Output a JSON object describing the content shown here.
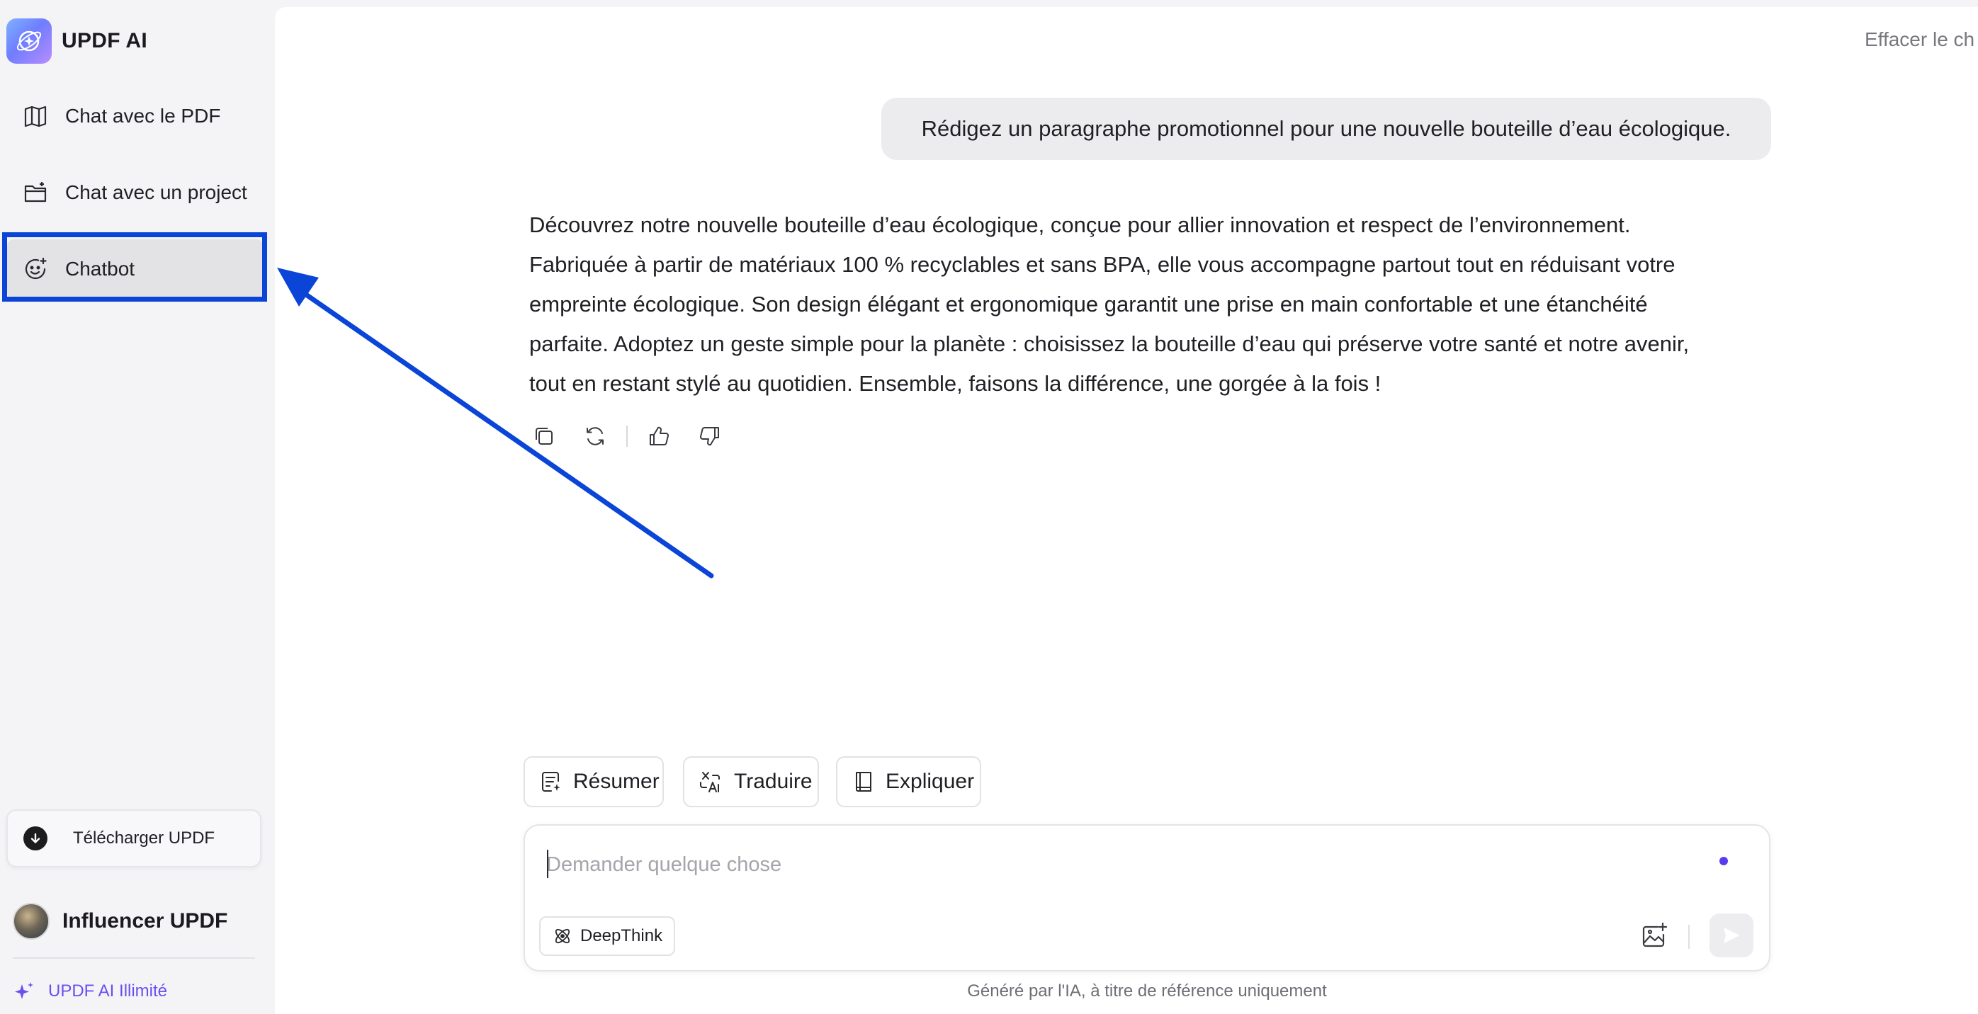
{
  "brand": {
    "name": "UPDF AI"
  },
  "sidebar": {
    "items": [
      {
        "label": "Chat avec le PDF",
        "icon": "book-icon"
      },
      {
        "label": "Chat avec un project",
        "icon": "folder-icon"
      },
      {
        "label": "Chatbot",
        "icon": "bot-icon",
        "active": true
      }
    ],
    "download": {
      "label": "Télécharger UPDF",
      "icon": "download-icon"
    },
    "user": {
      "name": "Influencer UPDF"
    },
    "plan": {
      "label": "UPDF AI Illimité",
      "color": "#6b4ef0"
    }
  },
  "header": {
    "clear_label": "Effacer le ch"
  },
  "conversation": {
    "user_message": "Rédigez un paragraphe promotionnel pour une nouvelle bouteille d’eau écologique.",
    "answer_lines": [
      "Découvrez notre nouvelle bouteille d’eau écologique, conçue pour allier innovation et respect de l’environnement.",
      "Fabriquée à partir de matériaux 100 % recyclables et sans BPA, elle vous accompagne partout tout en réduisant votre",
      "empreinte écologique. Son design élégant et ergonomique garantit une prise en main confortable et une étanchéité",
      "parfaite. Adoptez un geste simple pour la planète : choisissez la bouteille d’eau qui préserve votre santé et notre avenir,",
      "tout en restant stylé au quotidien. Ensemble, faisons la différence, une gorgée à la fois !"
    ],
    "actions": [
      "copy-icon",
      "regenerate-icon",
      "thumbs-up-icon",
      "thumbs-down-icon"
    ]
  },
  "quick_actions": [
    {
      "label": "Résumer",
      "icon": "summary-icon"
    },
    {
      "label": "Traduire",
      "icon": "translate-icon"
    },
    {
      "label": "Expliquer",
      "icon": "book-open-icon"
    }
  ],
  "composer": {
    "placeholder": "Demander quelque chose",
    "deepthink_label": "DeepThink"
  },
  "disclaimer": "Généré par l'IA, à titre de référence uniquement",
  "annotation": {
    "color": "#0a45d8"
  }
}
